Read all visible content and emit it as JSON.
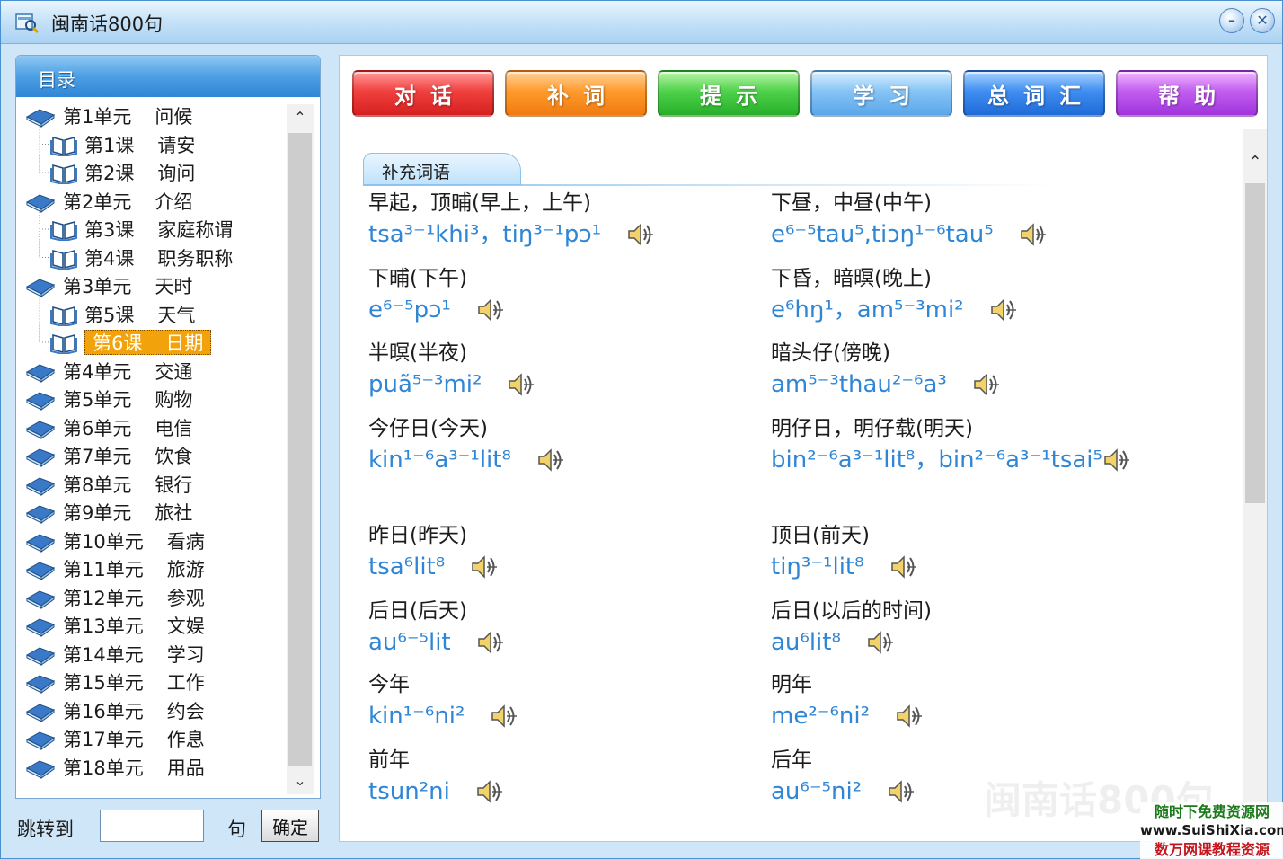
{
  "window": {
    "title": "闽南话800句"
  },
  "sidebar": {
    "header": "目录",
    "items": [
      {
        "type": "unit",
        "num": "第1单元",
        "name": "问候"
      },
      {
        "type": "lesson",
        "num": "第1课",
        "name": "请安"
      },
      {
        "type": "lesson",
        "num": "第2课",
        "name": "询问"
      },
      {
        "type": "unit",
        "num": "第2单元",
        "name": "介绍"
      },
      {
        "type": "lesson",
        "num": "第3课",
        "name": "家庭称谓"
      },
      {
        "type": "lesson",
        "num": "第4课",
        "name": "职务职称"
      },
      {
        "type": "unit",
        "num": "第3单元",
        "name": "天时"
      },
      {
        "type": "lesson",
        "num": "第5课",
        "name": "天气"
      },
      {
        "type": "lesson",
        "num": "第6课",
        "name": "日期",
        "selected": true
      },
      {
        "type": "unit",
        "num": "第4单元",
        "name": "交通"
      },
      {
        "type": "unit",
        "num": "第5单元",
        "name": "购物"
      },
      {
        "type": "unit",
        "num": "第6单元",
        "name": "电信"
      },
      {
        "type": "unit",
        "num": "第7单元",
        "name": "饮食"
      },
      {
        "type": "unit",
        "num": "第8单元",
        "name": "银行"
      },
      {
        "type": "unit",
        "num": "第9单元",
        "name": "旅社"
      },
      {
        "type": "unit",
        "num": "第10单元",
        "name": "看病"
      },
      {
        "type": "unit",
        "num": "第11单元",
        "name": "旅游"
      },
      {
        "type": "unit",
        "num": "第12单元",
        "name": "参观"
      },
      {
        "type": "unit",
        "num": "第13单元",
        "name": "文娱"
      },
      {
        "type": "unit",
        "num": "第14单元",
        "name": "学习"
      },
      {
        "type": "unit",
        "num": "第15单元",
        "name": "工作"
      },
      {
        "type": "unit",
        "num": "第16单元",
        "name": "约会"
      },
      {
        "type": "unit",
        "num": "第17单元",
        "name": "作息"
      },
      {
        "type": "unit",
        "num": "第18单元",
        "name": "用品"
      }
    ]
  },
  "jump": {
    "label": "跳转到",
    "value": "",
    "unit": "句",
    "ok": "确定"
  },
  "tabs": [
    {
      "label": "对话",
      "color": "#e83232"
    },
    {
      "label": "补词",
      "color": "#f88c1e"
    },
    {
      "label": "提示",
      "color": "#3cc43a"
    },
    {
      "label": "学习",
      "color": "#7ab9f2"
    },
    {
      "label": "总词汇",
      "color": "#2f7ee6"
    },
    {
      "label": "帮助",
      "color": "#b24be8"
    }
  ],
  "content": {
    "section_title": "补充词语",
    "watermark": "闽南话800句",
    "entries": [
      {
        "zh": "早起，顶晡(早上，上午)",
        "py": "tsa³⁻¹khi³，tiŋ³⁻¹pɔ¹"
      },
      {
        "zh": "下昼，中昼(中午)",
        "py": "e⁶⁻⁵tau⁵,tiɔŋ¹⁻⁶tau⁵"
      },
      {
        "zh": "下晡(下午)",
        "py": "e⁶⁻⁵pɔ¹"
      },
      {
        "zh": "下昏，暗暝(晚上)",
        "py": "e⁶hŋ¹，am⁵⁻³mi²"
      },
      {
        "zh": "半暝(半夜)",
        "py": "puã⁵⁻³mi²"
      },
      {
        "zh": "暗头仔(傍晚)",
        "py": "am⁵⁻³thau²⁻⁶a³"
      },
      {
        "zh": "今仔日(今天)",
        "py": "kin¹⁻⁶a³⁻¹lit⁸"
      },
      {
        "zh": "明仔日，明仔载(明天)",
        "py": "bin²⁻⁶a³⁻¹lit⁸，bin²⁻⁶a³⁻¹tsai⁵"
      },
      {
        "zh": "昨日(昨天)",
        "py": "tsa⁶lit⁸"
      },
      {
        "zh": "顶日(前天)",
        "py": "tiŋ³⁻¹lit⁸"
      },
      {
        "zh": "后日(后天)",
        "py": "au⁶⁻⁵lit"
      },
      {
        "zh": "后日(以后的时间)",
        "py": "au⁶lit⁸"
      },
      {
        "zh": "今年",
        "py": "kin¹⁻⁶ni²"
      },
      {
        "zh": "明年",
        "py": "me²⁻⁶ni²"
      },
      {
        "zh": "前年",
        "py": "tsun²ni"
      },
      {
        "zh": "后年",
        "py": "au⁶⁻⁵ni²"
      }
    ]
  },
  "corner_logo": {
    "line1": "随时下免费资源网",
    "line2": "www.SuiShiXia.com",
    "line3": "数万网课教程资源"
  }
}
